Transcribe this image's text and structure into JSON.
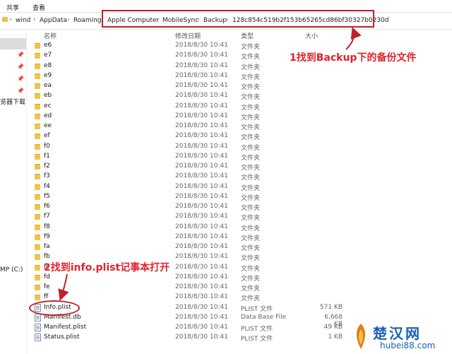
{
  "ribbon": {
    "tabs": [
      "共享",
      "查看"
    ]
  },
  "breadcrumb": [
    "wind",
    "AppData",
    "Roaming",
    "Apple Computer",
    "MobileSync",
    "Backup",
    "128c854c519b2f153b65265cd86bf30327b0230d"
  ],
  "columns": {
    "name": "名称",
    "date": "修改日期",
    "type": "类型",
    "size": "大小"
  },
  "nav": {
    "downloads_label": "览器下载",
    "drive_label": "MP (C:)"
  },
  "files": [
    {
      "name": "e6",
      "date": "2018/8/30 10:41",
      "type": "文件夹",
      "size": "",
      "kind": "folder"
    },
    {
      "name": "e7",
      "date": "2018/8/30 10:41",
      "type": "文件夹",
      "size": "",
      "kind": "folder"
    },
    {
      "name": "e8",
      "date": "2018/8/30 10:41",
      "type": "文件夹",
      "size": "",
      "kind": "folder"
    },
    {
      "name": "e9",
      "date": "2018/8/30 10:41",
      "type": "文件夹",
      "size": "",
      "kind": "folder"
    },
    {
      "name": "ea",
      "date": "2018/8/30 10:41",
      "type": "文件夹",
      "size": "",
      "kind": "folder"
    },
    {
      "name": "eb",
      "date": "2018/8/30 10:41",
      "type": "文件夹",
      "size": "",
      "kind": "folder"
    },
    {
      "name": "ec",
      "date": "2018/8/30 10:41",
      "type": "文件夹",
      "size": "",
      "kind": "folder"
    },
    {
      "name": "ed",
      "date": "2018/8/30 10:41",
      "type": "文件夹",
      "size": "",
      "kind": "folder"
    },
    {
      "name": "ee",
      "date": "2018/8/30 10:41",
      "type": "文件夹",
      "size": "",
      "kind": "folder"
    },
    {
      "name": "ef",
      "date": "2018/8/30 10:41",
      "type": "文件夹",
      "size": "",
      "kind": "folder"
    },
    {
      "name": "f0",
      "date": "2018/8/30 10:41",
      "type": "文件夹",
      "size": "",
      "kind": "folder"
    },
    {
      "name": "f1",
      "date": "2018/8/30 10:41",
      "type": "文件夹",
      "size": "",
      "kind": "folder"
    },
    {
      "name": "f2",
      "date": "2018/8/30 10:41",
      "type": "文件夹",
      "size": "",
      "kind": "folder"
    },
    {
      "name": "f3",
      "date": "2018/8/30 10:41",
      "type": "文件夹",
      "size": "",
      "kind": "folder"
    },
    {
      "name": "f4",
      "date": "2018/8/30 10:41",
      "type": "文件夹",
      "size": "",
      "kind": "folder"
    },
    {
      "name": "f5",
      "date": "2018/8/30 10:41",
      "type": "文件夹",
      "size": "",
      "kind": "folder"
    },
    {
      "name": "f6",
      "date": "2018/8/30 10:41",
      "type": "文件夹",
      "size": "",
      "kind": "folder"
    },
    {
      "name": "f7",
      "date": "2018/8/30 10:41",
      "type": "文件夹",
      "size": "",
      "kind": "folder"
    },
    {
      "name": "f8",
      "date": "2018/8/30 10:41",
      "type": "文件夹",
      "size": "",
      "kind": "folder"
    },
    {
      "name": "f9",
      "date": "2018/8/30 10:41",
      "type": "文件夹",
      "size": "",
      "kind": "folder"
    },
    {
      "name": "fa",
      "date": "2018/8/30 10:41",
      "type": "文件夹",
      "size": "",
      "kind": "folder"
    },
    {
      "name": "fb",
      "date": "2018/8/30 10:41",
      "type": "文件夹",
      "size": "",
      "kind": "folder"
    },
    {
      "name": "fc",
      "date": "2018/8/30 10:41",
      "type": "文件夹",
      "size": "",
      "kind": "folder"
    },
    {
      "name": "fd",
      "date": "2018/8/30 10:41",
      "type": "文件夹",
      "size": "",
      "kind": "folder"
    },
    {
      "name": "fe",
      "date": "2018/8/30 10:41",
      "type": "文件夹",
      "size": "",
      "kind": "folder"
    },
    {
      "name": "ff",
      "date": "2018/8/30 10:41",
      "type": "文件夹",
      "size": "",
      "kind": "folder"
    },
    {
      "name": "Info.plist",
      "date": "2018/8/30 10:41",
      "type": "PLIST 文件",
      "size": "571 KB",
      "kind": "file"
    },
    {
      "name": "Manifest.db",
      "date": "2018/8/30 10:41",
      "type": "Data Base File",
      "size": "6,668 KB",
      "kind": "file"
    },
    {
      "name": "Manifest.plist",
      "date": "2018/8/30 10:41",
      "type": "PLIST 文件",
      "size": "49 KB",
      "kind": "file"
    },
    {
      "name": "Status.plist",
      "date": "2018/8/30 10:41",
      "type": "PLIST 文件",
      "size": "1 KB",
      "kind": "file"
    }
  ],
  "annotations": {
    "step1": "1找到Backup下的备份文件",
    "step2": "2找到info.plist记事本打开"
  },
  "watermark": {
    "title": "楚汉网",
    "url": "hubei88.com"
  },
  "colors": {
    "annotation": "#e0232b",
    "highlight_border": "#c0202a",
    "folder": "#f0c64a",
    "watermark": "#1a5fb4"
  }
}
